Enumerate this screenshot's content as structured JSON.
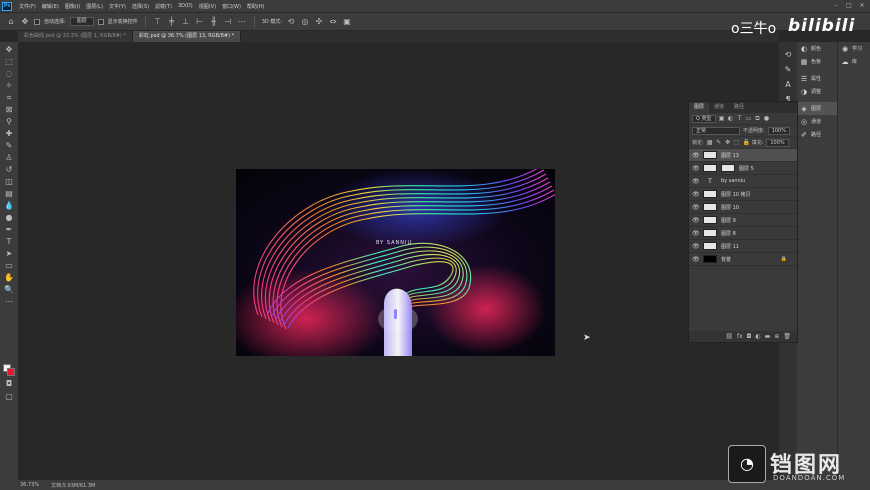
{
  "menubar": {
    "logo": "Ps",
    "items": [
      "文件(F)",
      "编辑(E)",
      "图像(I)",
      "图层(L)",
      "文字(Y)",
      "选择(S)",
      "滤镜(T)",
      "3D(D)",
      "视图(V)",
      "窗口(W)",
      "帮助(H)"
    ]
  },
  "options": {
    "auto_select_label": "自动选择:",
    "auto_select_value": "图层",
    "show_transform_label": "显示变换控件",
    "mode_3d_label": "3D 模式:"
  },
  "tabs": [
    {
      "label": "彩色曲线.psd @ 33.3% (图层 1, RGB/8#) *",
      "active": false
    },
    {
      "label": "彩虹.psd @ 36.7% (图层 13, RGB/8#) *",
      "active": true
    }
  ],
  "artwork": {
    "caption": "BY SANNIU",
    "colors": {
      "bg": "#0a0514",
      "glow": "#ff2a5f",
      "accent": "#00e0ff"
    }
  },
  "status": {
    "zoom": "36.73%",
    "doc": "文档:5.93M/61.3M"
  },
  "dock": {
    "group1": [
      "颜色",
      "色板"
    ],
    "group2": [
      "属性",
      "调整"
    ],
    "group3": [
      "图层",
      "通道",
      "路径"
    ],
    "col2": [
      "学习",
      "库"
    ]
  },
  "layers_panel": {
    "tabs": [
      "图层",
      "通道",
      "路径"
    ],
    "filter_kind": "Q 类型",
    "blend_mode": "正常",
    "opacity_label": "不透明度:",
    "opacity_value": "100%",
    "lock_label": "锁定:",
    "fill_label": "填充:",
    "fill_value": "100%",
    "layers": [
      {
        "name": "图层 13",
        "thumb": "white",
        "selected": true
      },
      {
        "name": "图层 5",
        "thumb": "mask",
        "selected": false
      },
      {
        "name": "by sanniu",
        "thumb": "text",
        "selected": false
      },
      {
        "name": "图层 10 拷贝",
        "thumb": "white",
        "selected": false
      },
      {
        "name": "图层 10",
        "thumb": "white",
        "selected": false
      },
      {
        "name": "图层 9",
        "thumb": "white",
        "selected": false
      },
      {
        "name": "图层 8",
        "thumb": "white",
        "selected": false
      },
      {
        "name": "图层 11",
        "thumb": "white",
        "selected": false
      },
      {
        "name": "背景",
        "thumb": "black",
        "selected": false,
        "locked": true
      }
    ]
  },
  "watermark": {
    "uploader": "o三牛o",
    "site": "bilibili",
    "brand": "铛图网",
    "url": "DOANDOAN.COM"
  }
}
